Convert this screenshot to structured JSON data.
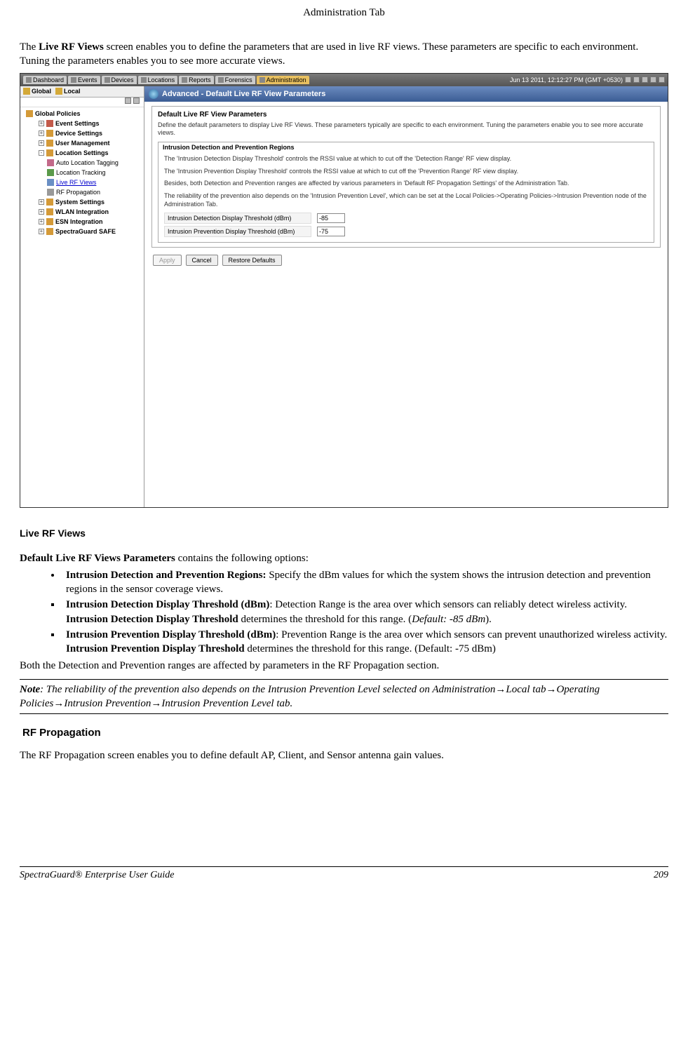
{
  "header": {
    "title": "Administration Tab"
  },
  "intro": {
    "prefix": "The ",
    "bold": "Live RF Views",
    "rest": " screen enables you to define the parameters that are used in live RF views. These parameters are specific to each environment. Tuning the parameters enables you to see more accurate views."
  },
  "app": {
    "tabs": [
      "Dashboard",
      "Events",
      "Devices",
      "Locations",
      "Reports",
      "Forensics",
      "Administration"
    ],
    "active_tab": "Administration",
    "timestamp": "Jun 13 2011, 12:12:27 PM (GMT +0530)",
    "sidebar": {
      "global": "Global",
      "local": "Local",
      "items": [
        {
          "label": "Global Policies",
          "icon": "folder"
        },
        {
          "exp": "+",
          "label": "Event Settings",
          "icon": "red"
        },
        {
          "exp": "+",
          "label": "Device Settings",
          "icon": "folder"
        },
        {
          "exp": "+",
          "label": "User Management",
          "icon": "folder"
        },
        {
          "exp": "-",
          "label": "Location Settings",
          "icon": "folder",
          "children": [
            {
              "label": "Auto Location Tagging",
              "icon": "pink"
            },
            {
              "label": "Location Tracking",
              "icon": "green"
            },
            {
              "label": "Live RF Views",
              "icon": "blue",
              "selected": true
            },
            {
              "label": "RF Propagation",
              "icon": "gray"
            }
          ]
        },
        {
          "exp": "+",
          "label": "System Settings",
          "icon": "folder"
        },
        {
          "exp": "+",
          "label": "WLAN Integration",
          "icon": "folder"
        },
        {
          "exp": "+",
          "label": "ESN Integration",
          "icon": "folder"
        },
        {
          "exp": "+",
          "label": "SpectraGuard SAFE",
          "icon": "folder"
        }
      ]
    },
    "main": {
      "title": "Advanced - Default Live RF View Parameters",
      "fieldset_title": "Default Live RF View Parameters",
      "desc1": "Define the default parameters to display Live RF Views. These parameters typically are specific to each environment. Tuning the parameters enable you to see more accurate views.",
      "subtitle": "Intrusion Detection and Prevention Regions",
      "para1": "The 'Intrusion Detection Display Threshold' controls the RSSI value at which to cut off the 'Detection Range' RF view display.",
      "para2": "The 'Intrusion Prevention Display Threshold' controls the RSSI value at which to cut off the 'Prevention Range' RF view display.",
      "para3": "Besides, both Detection and Prevention ranges are affected by various parameters in 'Default RF Propagation Settings' of the Administration Tab.",
      "para4": "The reliability of the prevention also depends on the 'Intrusion Prevention Level', which can be set at the Local Policies->Operating Policies->Intrusion Prevention node of the Administration Tab.",
      "param1_label": "Intrusion Detection Display Threshold (dBm)",
      "param1_value": "-85",
      "param2_label": "Intrusion Prevention Display Threshold (dBm)",
      "param2_value": "-75",
      "buttons": {
        "apply": "Apply",
        "cancel": "Cancel",
        "restore": "Restore Defaults"
      }
    }
  },
  "doc": {
    "caption": "Live RF Views",
    "line1a": "Default Live RF Views Parameters",
    "line1b": " contains the following options:",
    "bullets": {
      "b1_bold": "Intrusion Detection and Prevention Regions:",
      "b1_rest": " Specify the dBm values for which the system shows the intrusion detection and prevention regions in the sensor coverage views.",
      "b2_bold": "Intrusion Detection Display Threshold (dBm)",
      "b2_mid1": ": Detection Range is the area over which sensors can reliably detect wireless activity. ",
      "b2_bold2": "Intrusion Detection Display Threshold",
      "b2_mid2": " determines the threshold for this range. (",
      "b2_italic": "Default: -85 dBm",
      "b2_end": ").",
      "b3_bold": "Intrusion Prevention Display Threshold (dBm)",
      "b3_mid1": ": Prevention Range is the area over which sensors can prevent unauthorized wireless activity. ",
      "b3_bold2": "Intrusion Prevention Display Threshold",
      "b3_end": " determines the threshold for this range. (Default: -75 dBm)"
    },
    "after_bullets": "Both the Detection and Prevention ranges are affected by parameters in the RF Propagation section.",
    "note_bold": "Note",
    "note_rest": ": The reliability of the prevention also depends on the Intrusion Prevention Level selected on Administration",
    "note_p2": "Local tab",
    "note_p3": "Operating Policies",
    "note_p4": "Intrusion Prevention",
    "note_p5": "Intrusion Prevention Level tab.",
    "rf_heading": "RF Propagation",
    "rf_text": "The RF Propagation screen enables you to define default AP, Client, and Sensor antenna gain values."
  },
  "footer": {
    "left": "SpectraGuard®  Enterprise User Guide",
    "right": "209"
  }
}
